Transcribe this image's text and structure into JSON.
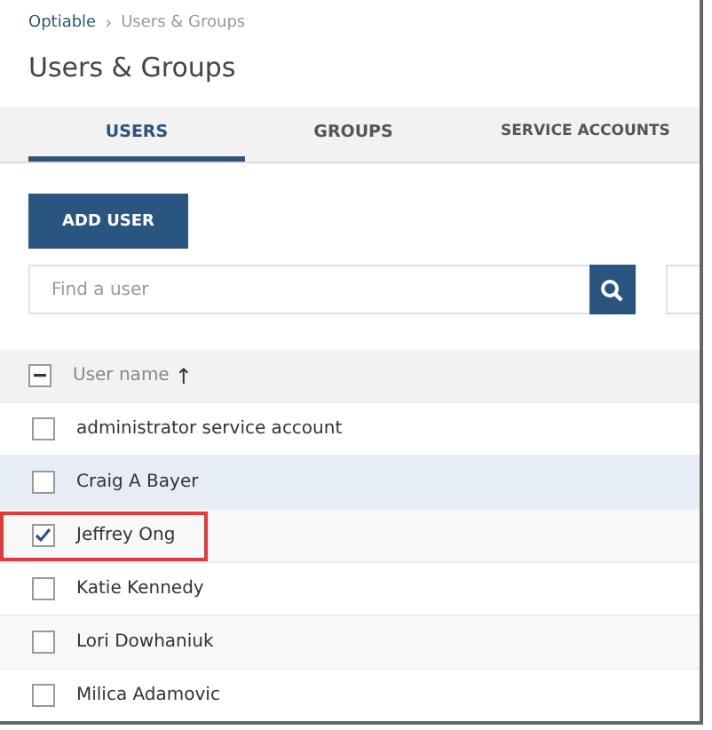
{
  "breadcrumb": [
    {
      "label": "Optiable",
      "link": true
    },
    {
      "label": "Users & Groups",
      "link": false
    }
  ],
  "breadcrumb_separator": "›",
  "title": "Users & Groups",
  "tabs": [
    {
      "label": "USERS",
      "selected": true
    },
    {
      "label": "GROUPS",
      "selected": false
    },
    {
      "label": "SERVICE ACCOUNTS",
      "selected": false
    }
  ],
  "add_button": "ADD USER",
  "search": {
    "placeholder": "Find a user"
  },
  "table": {
    "header": {
      "label": "User name",
      "sort_arrow": "↑",
      "indeterminate": true
    },
    "rows": [
      {
        "name": "administrator service account",
        "checked": false,
        "hovered": false,
        "highlighted": false
      },
      {
        "name": "Craig A Bayer",
        "checked": false,
        "hovered": true,
        "highlighted": false
      },
      {
        "name": "Jeffrey Ong",
        "checked": true,
        "hovered": false,
        "highlighted": true
      },
      {
        "name": "Katie Kennedy",
        "checked": false,
        "hovered": false,
        "highlighted": false
      },
      {
        "name": "Lori Dowhaniuk",
        "checked": false,
        "hovered": false,
        "highlighted": false
      },
      {
        "name": "Milica Adamovic",
        "checked": false,
        "hovered": false,
        "highlighted": false
      }
    ]
  }
}
